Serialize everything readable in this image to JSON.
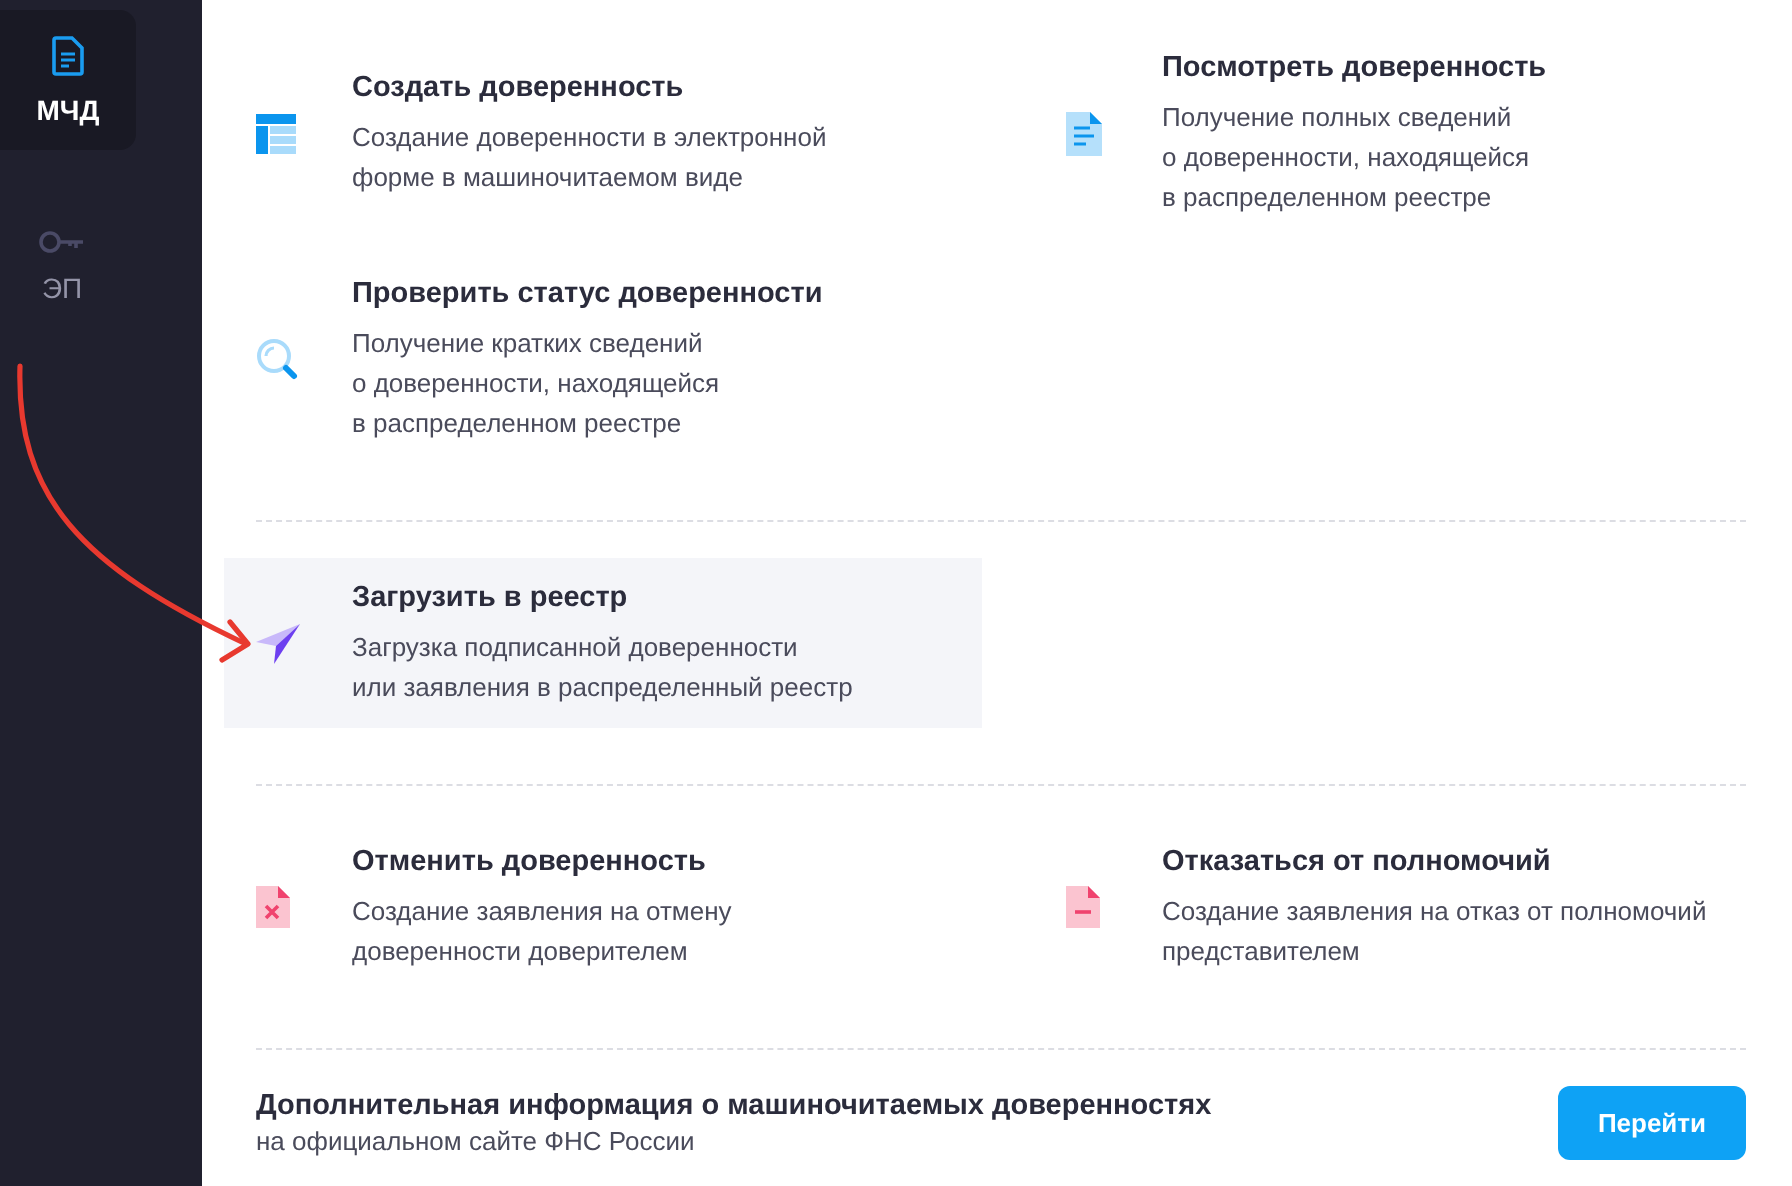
{
  "sidebar": {
    "items": [
      {
        "label": "МЧД",
        "kind": "document",
        "selected": true
      },
      {
        "label": "ЭП",
        "kind": "key",
        "selected": false
      }
    ]
  },
  "sections": [
    {
      "items": [
        {
          "kind": "table",
          "title": "Создать доверенность",
          "description": "Создание доверенности в электронной\nформе в машиночитаемом виде",
          "selected": false
        },
        {
          "kind": "document",
          "title": "Посмотреть доверенность",
          "description": "Получение полных сведений\nо доверенности, находящейся\nв распределенном реестре",
          "selected": false
        },
        {
          "kind": "search",
          "title": "Проверить статус доверенности",
          "description": "Получение кратких сведений\nо доверенности, находящейся\nв распределенном реестре",
          "selected": false
        }
      ]
    },
    {
      "items": [
        {
          "kind": "send",
          "title": "Загрузить в реестр",
          "description": "Загрузка подписанной доверенности\nили заявления в распределенный реестр",
          "selected": true
        }
      ]
    },
    {
      "items": [
        {
          "kind": "cancel",
          "title": "Отменить доверенность",
          "description": "Создание заявления на отмену\nдоверенности доверителем",
          "selected": false
        },
        {
          "kind": "remove",
          "title": "Отказаться от полномочий",
          "description": "Создание заявления на отказ от полномочий\nпредставителем",
          "selected": false
        }
      ]
    }
  ],
  "footer": {
    "title": "Дополнительная информация о машиночитаемых доверенностях",
    "subtitle": "на официальном сайте ФНС России",
    "button": "Перейти"
  }
}
